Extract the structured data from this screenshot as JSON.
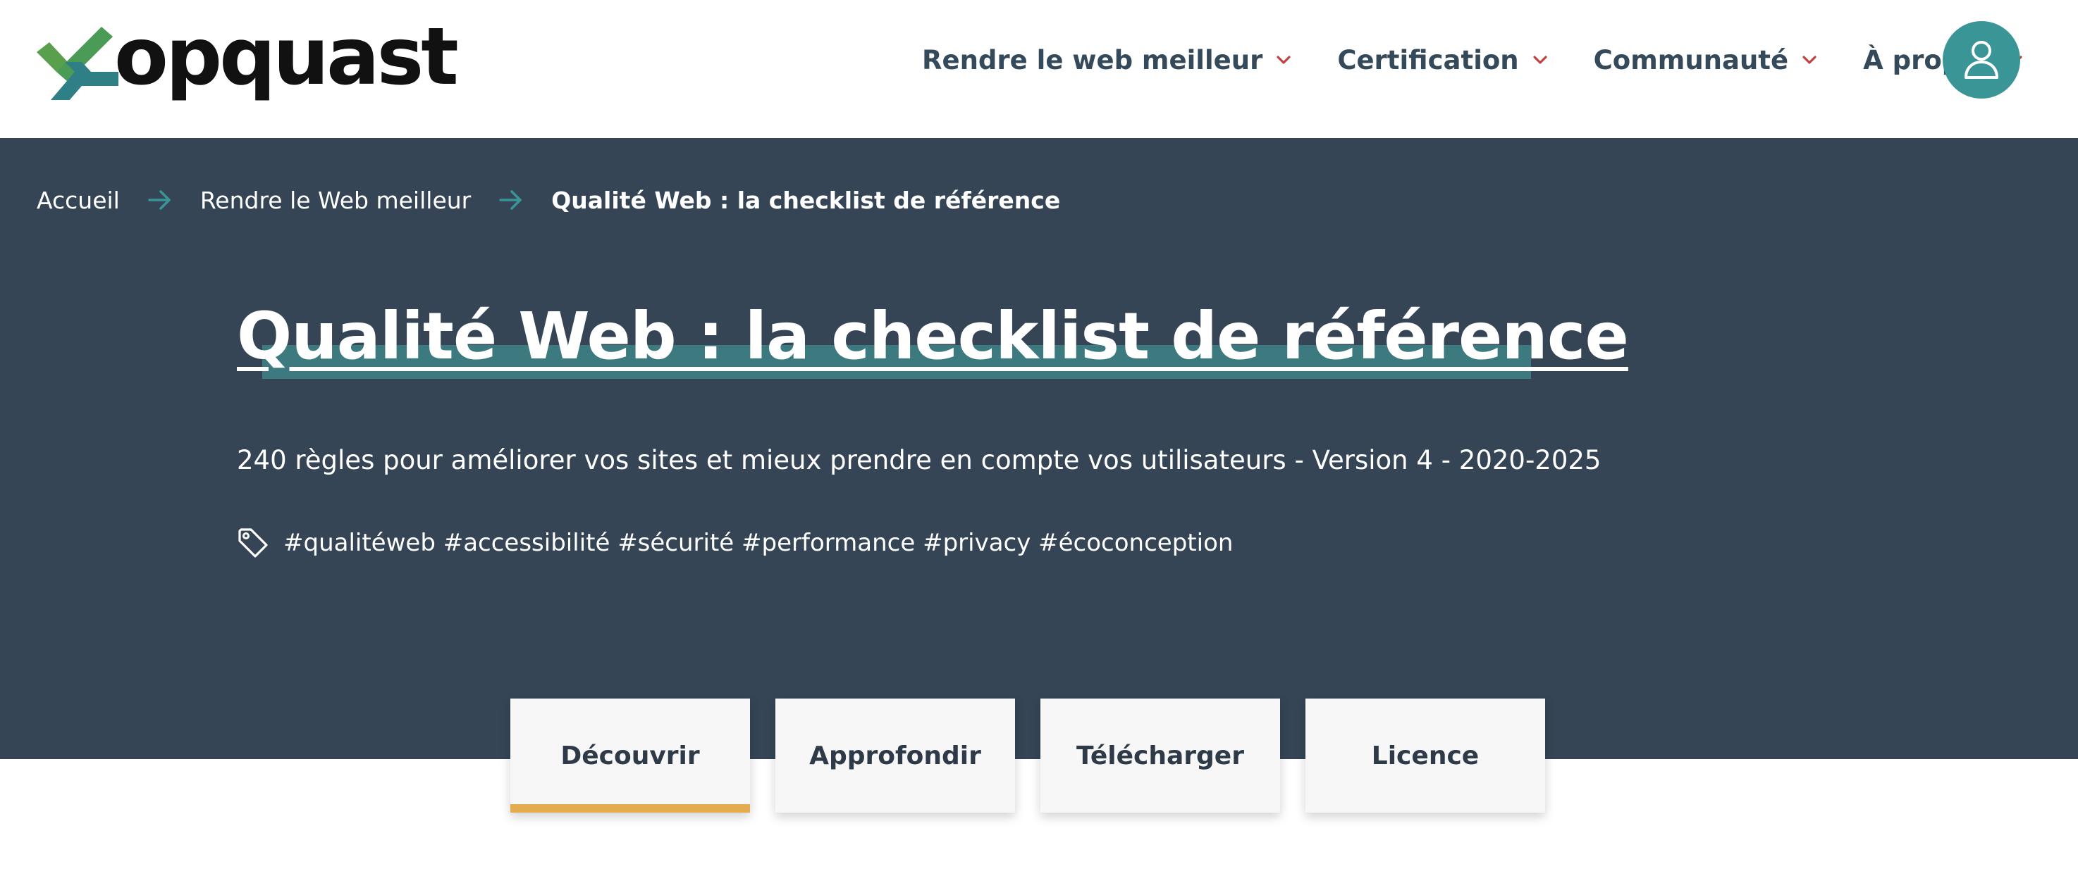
{
  "brand": {
    "name": "opquast"
  },
  "nav": {
    "items": [
      {
        "label": "Rendre le web meilleur"
      },
      {
        "label": "Certification"
      },
      {
        "label": "Communauté"
      },
      {
        "label": "À propos"
      }
    ]
  },
  "colors": {
    "nav_chevron": "#c0433f",
    "hero_bg": "#354555",
    "accent_teal": "#3a9597",
    "tab_active": "#e4ac4f"
  },
  "user": {
    "icon": "user-icon"
  },
  "breadcrumb": {
    "items": [
      {
        "label": "Accueil"
      },
      {
        "label": "Rendre le Web meilleur"
      },
      {
        "label": "Qualité Web : la checklist de référence"
      }
    ],
    "separator_icon": "arrow-right-icon"
  },
  "page": {
    "title": "Qualité Web : la checklist de référence",
    "subtitle": "240 règles pour améliorer vos sites et mieux prendre en compte vos utilisateurs - Version 4 - 2020-2025",
    "tags_icon": "tag-icon",
    "tags": "#qualitéweb #accessibilité #sécurité #performance #privacy #écoconception"
  },
  "tabs": [
    {
      "label": "Découvrir",
      "active": true
    },
    {
      "label": "Approfondir",
      "active": false
    },
    {
      "label": "Télécharger",
      "active": false
    },
    {
      "label": "Licence",
      "active": false
    }
  ]
}
